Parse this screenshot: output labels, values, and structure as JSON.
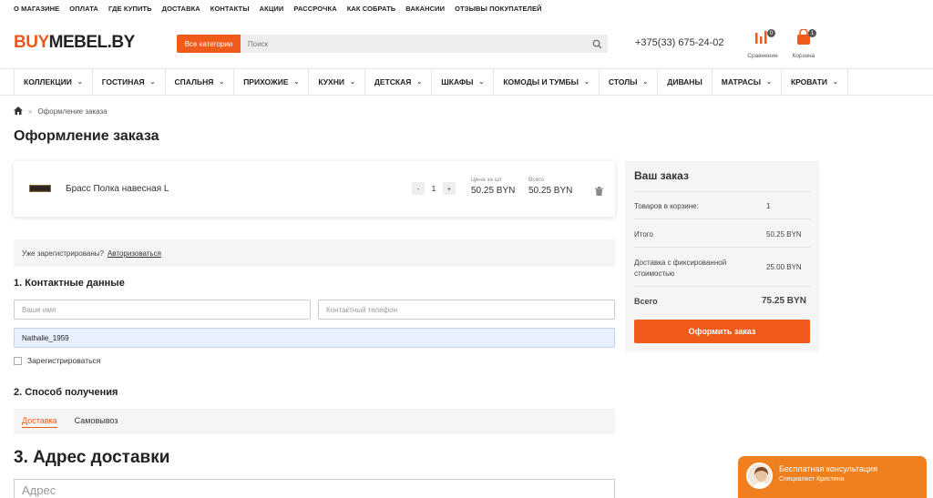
{
  "top_links": [
    "О МАГАЗИНЕ",
    "ОПЛАТА",
    "ГДЕ КУПИТЬ",
    "ДОСТАВКА",
    "КОНТАКТЫ",
    "АКЦИИ",
    "РАССРОЧКА",
    "КАК СОБРАТЬ",
    "ВАКАНСИИ",
    "ОТЗЫВЫ ПОКУПАТЕЛЕЙ"
  ],
  "header": {
    "logo_part1": "BUY",
    "logo_part2": "MEBEL.BY",
    "category_button": "Все категории",
    "search_placeholder": "Поиск",
    "phone": "+375(33) 675-24-02",
    "compare_label": "Сравнение",
    "compare_count": "0",
    "cart_label": "Корзина",
    "cart_count": "1"
  },
  "categories": [
    {
      "label": "КОЛЛЕКЦИИ",
      "has_dropdown": true
    },
    {
      "label": "ГОСТИНАЯ",
      "has_dropdown": true
    },
    {
      "label": "СПАЛЬНЯ",
      "has_dropdown": true
    },
    {
      "label": "ПРИХОЖИЕ",
      "has_dropdown": true
    },
    {
      "label": "КУХНИ",
      "has_dropdown": true
    },
    {
      "label": "ДЕТСКАЯ",
      "has_dropdown": true
    },
    {
      "label": "ШКАФЫ",
      "has_dropdown": true
    },
    {
      "label": "КОМОДЫ И ТУМБЫ",
      "has_dropdown": true
    },
    {
      "label": "СТОЛЫ",
      "has_dropdown": true
    },
    {
      "label": "ДИВАНЫ",
      "has_dropdown": false
    },
    {
      "label": "МАТРАСЫ",
      "has_dropdown": true
    },
    {
      "label": "КРОВАТИ",
      "has_dropdown": true
    }
  ],
  "breadcrumb": {
    "separator": "»",
    "current": "Оформление заказа"
  },
  "page_title": "Оформление заказа",
  "cart_item": {
    "name": "Брасс Полка навесная L",
    "qty_minus": "-",
    "qty": "1",
    "qty_plus": "+",
    "unit_price_caption": "Цена за шт",
    "unit_price": "50.25 BYN",
    "total_caption": "Всего",
    "total": "50.25 BYN"
  },
  "login": {
    "text": "Уже зарегистрированы?",
    "link": "Авторизоваться"
  },
  "contact": {
    "heading": "1. Контактные данные",
    "name_placeholder": "Ваше имя",
    "phone_placeholder": "Контактный телефон",
    "login_value": "Nathalie_1959",
    "register_label": "Зарегистрироваться"
  },
  "delivery": {
    "heading": "2. Способ получения",
    "tabs": [
      "Доставка",
      "Самовывоз"
    ],
    "active_tab": "Доставка"
  },
  "address": {
    "heading": "3. Адрес доставки",
    "placeholder": "Адрес"
  },
  "summary": {
    "heading": "Ваш заказ",
    "rows": [
      {
        "label": "Товаров в корзине:",
        "value": "1"
      },
      {
        "label": "Итого",
        "value": "50.25 BYN"
      },
      {
        "label": "Доставка с фиксированной стоимостью",
        "value": "25.00 BYN"
      }
    ],
    "total_label": "Всего",
    "total_value": "75.25 BYN",
    "submit_label": "Оформить заказ"
  },
  "consultation": {
    "title": "Бесплатная консультация",
    "subtitle": "Специалист Кристина"
  },
  "colors": {
    "accent": "#f05a1a",
    "widget": "#f07f1e",
    "panel": "#f5f5f5",
    "autofill": "#e8f0fe"
  }
}
